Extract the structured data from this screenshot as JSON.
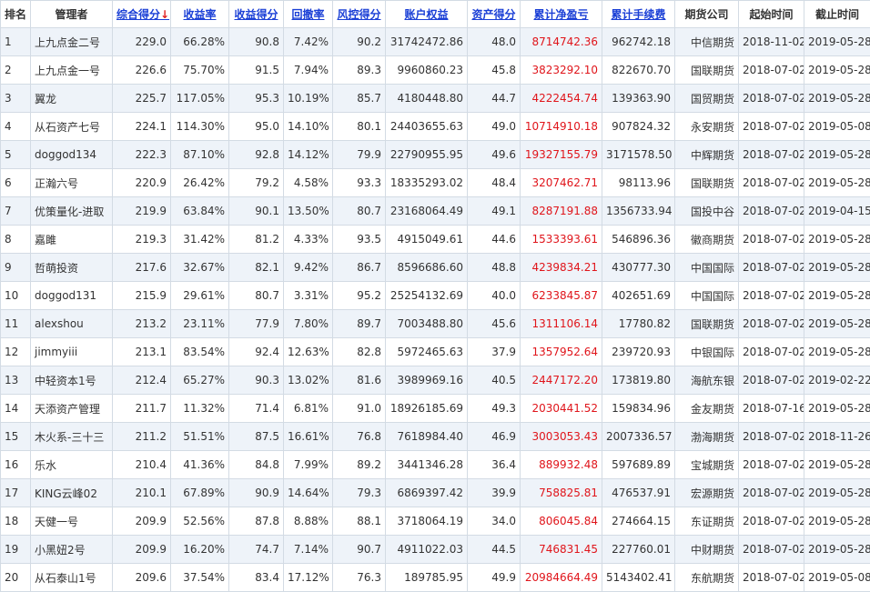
{
  "table": {
    "columns": [
      {
        "key": "rank",
        "label": "排名",
        "sortable": false,
        "sorted": false
      },
      {
        "key": "manager",
        "label": "管理者",
        "sortable": false,
        "sorted": false
      },
      {
        "key": "overall",
        "label": "综合得分",
        "sortable": true,
        "sorted": true,
        "arrow": "↓"
      },
      {
        "key": "return_rate",
        "label": "收益率",
        "sortable": true,
        "sorted": false
      },
      {
        "key": "return_score",
        "label": "收益得分",
        "sortable": true,
        "sorted": false
      },
      {
        "key": "drawdown",
        "label": "回撤率",
        "sortable": true,
        "sorted": false
      },
      {
        "key": "risk_score",
        "label": "风控得分",
        "sortable": true,
        "sorted": false
      },
      {
        "key": "equity",
        "label": "账户权益",
        "sortable": true,
        "sorted": false
      },
      {
        "key": "asset_score",
        "label": "资产得分",
        "sortable": true,
        "sorted": false
      },
      {
        "key": "net_pl",
        "label": "累计净盈亏",
        "sortable": true,
        "sorted": false
      },
      {
        "key": "fees",
        "label": "累计手续费",
        "sortable": true,
        "sorted": false
      },
      {
        "key": "broker",
        "label": "期货公司",
        "sortable": false,
        "sorted": false
      },
      {
        "key": "start",
        "label": "起始时间",
        "sortable": false,
        "sorted": false
      },
      {
        "key": "end",
        "label": "截止时间",
        "sortable": false,
        "sorted": false
      }
    ],
    "rows": [
      [
        "1",
        "上九点金二号",
        "229.0",
        "66.28%",
        "90.8",
        "7.42%",
        "90.2",
        "31742472.86",
        "48.0",
        "8714742.36",
        "962742.18",
        "中信期货",
        "2018-11-02",
        "2019-05-28"
      ],
      [
        "2",
        "上九点金一号",
        "226.6",
        "75.70%",
        "91.5",
        "7.94%",
        "89.3",
        "9960860.23",
        "45.8",
        "3823292.10",
        "822670.70",
        "国联期货",
        "2018-07-02",
        "2019-05-28"
      ],
      [
        "3",
        "翼龙",
        "225.7",
        "117.05%",
        "95.3",
        "10.19%",
        "85.7",
        "4180448.80",
        "44.7",
        "4222454.74",
        "139363.90",
        "国贸期货",
        "2018-07-02",
        "2019-05-28"
      ],
      [
        "4",
        "从石资产七号",
        "224.1",
        "114.30%",
        "95.0",
        "14.10%",
        "80.1",
        "24403655.63",
        "49.0",
        "10714910.18",
        "907824.32",
        "永安期货",
        "2018-07-02",
        "2019-05-08"
      ],
      [
        "5",
        "doggod134",
        "222.3",
        "87.10%",
        "92.8",
        "14.12%",
        "79.9",
        "22790955.95",
        "49.6",
        "19327155.79",
        "3171578.50",
        "中辉期货",
        "2018-07-02",
        "2019-05-28"
      ],
      [
        "6",
        "正瀚六号",
        "220.9",
        "26.42%",
        "79.2",
        "4.58%",
        "93.3",
        "18335293.02",
        "48.4",
        "3207462.71",
        "98113.96",
        "国联期货",
        "2018-07-02",
        "2019-05-28"
      ],
      [
        "7",
        "优策量化-进取",
        "219.9",
        "63.84%",
        "90.1",
        "13.50%",
        "80.7",
        "23168064.49",
        "49.1",
        "8287191.88",
        "1356733.94",
        "国投中谷",
        "2018-07-02",
        "2019-04-15"
      ],
      [
        "8",
        "嘉雎",
        "219.3",
        "31.42%",
        "81.2",
        "4.33%",
        "93.5",
        "4915049.61",
        "44.6",
        "1533393.61",
        "546896.36",
        "徽商期货",
        "2018-07-02",
        "2019-05-28"
      ],
      [
        "9",
        "哲萌投资",
        "217.6",
        "32.67%",
        "82.1",
        "9.42%",
        "86.7",
        "8596686.60",
        "48.8",
        "4239834.21",
        "430777.30",
        "中国国际",
        "2018-07-02",
        "2019-05-28"
      ],
      [
        "10",
        "doggod131",
        "215.9",
        "29.61%",
        "80.7",
        "3.31%",
        "95.2",
        "25254132.69",
        "40.0",
        "6233845.87",
        "402651.69",
        "中国国际",
        "2018-07-02",
        "2019-05-28"
      ],
      [
        "11",
        "alexshou",
        "213.2",
        "23.11%",
        "77.9",
        "7.80%",
        "89.7",
        "7003488.80",
        "45.6",
        "1311106.14",
        "17780.82",
        "国联期货",
        "2018-07-02",
        "2019-05-28"
      ],
      [
        "12",
        "jimmyiii",
        "213.1",
        "83.54%",
        "92.4",
        "12.63%",
        "82.8",
        "5972465.63",
        "37.9",
        "1357952.64",
        "239720.93",
        "中银国际",
        "2018-07-02",
        "2019-05-28"
      ],
      [
        "13",
        "中轻资本1号",
        "212.4",
        "65.27%",
        "90.3",
        "13.02%",
        "81.6",
        "3989969.16",
        "40.5",
        "2447172.20",
        "173819.80",
        "海航东银",
        "2018-07-02",
        "2019-02-22"
      ],
      [
        "14",
        "天添资产管理",
        "211.7",
        "11.32%",
        "71.4",
        "6.81%",
        "91.0",
        "18926185.69",
        "49.3",
        "2030441.52",
        "159834.96",
        "金友期货",
        "2018-07-16",
        "2019-05-28"
      ],
      [
        "15",
        "木火系-三十三",
        "211.2",
        "51.51%",
        "87.5",
        "16.61%",
        "76.8",
        "7618984.40",
        "46.9",
        "3003053.43",
        "2007336.57",
        "渤海期货",
        "2018-07-02",
        "2018-11-26"
      ],
      [
        "16",
        "乐水",
        "210.4",
        "41.36%",
        "84.8",
        "7.99%",
        "89.2",
        "3441346.28",
        "36.4",
        "889932.48",
        "597689.89",
        "宝城期货",
        "2018-07-02",
        "2019-05-28"
      ],
      [
        "17",
        "KING云峰02",
        "210.1",
        "67.89%",
        "90.9",
        "14.64%",
        "79.3",
        "6869397.42",
        "39.9",
        "758825.81",
        "476537.91",
        "宏源期货",
        "2018-07-02",
        "2019-05-28"
      ],
      [
        "18",
        "天健一号",
        "209.9",
        "52.56%",
        "87.8",
        "8.88%",
        "88.1",
        "3718064.19",
        "34.0",
        "806045.84",
        "274664.15",
        "东证期货",
        "2018-07-02",
        "2019-05-28"
      ],
      [
        "19",
        "小黑妞2号",
        "209.9",
        "16.20%",
        "74.7",
        "7.14%",
        "90.7",
        "4911022.03",
        "44.5",
        "746831.45",
        "227760.01",
        "中财期货",
        "2018-07-02",
        "2019-05-28"
      ],
      [
        "20",
        "从石泰山1号",
        "209.6",
        "37.54%",
        "83.4",
        "17.12%",
        "76.3",
        "189785.95",
        "49.9",
        "20984664.49",
        "5143402.41",
        "东航期货",
        "2018-07-02",
        "2019-05-08"
      ]
    ]
  },
  "colors": {
    "header_link": "#1a3fd6",
    "sort_arrow": "#e02020",
    "profit_text": "#e0151b",
    "row_stripe": "#eef3f9",
    "border": "#d3dbe4"
  }
}
